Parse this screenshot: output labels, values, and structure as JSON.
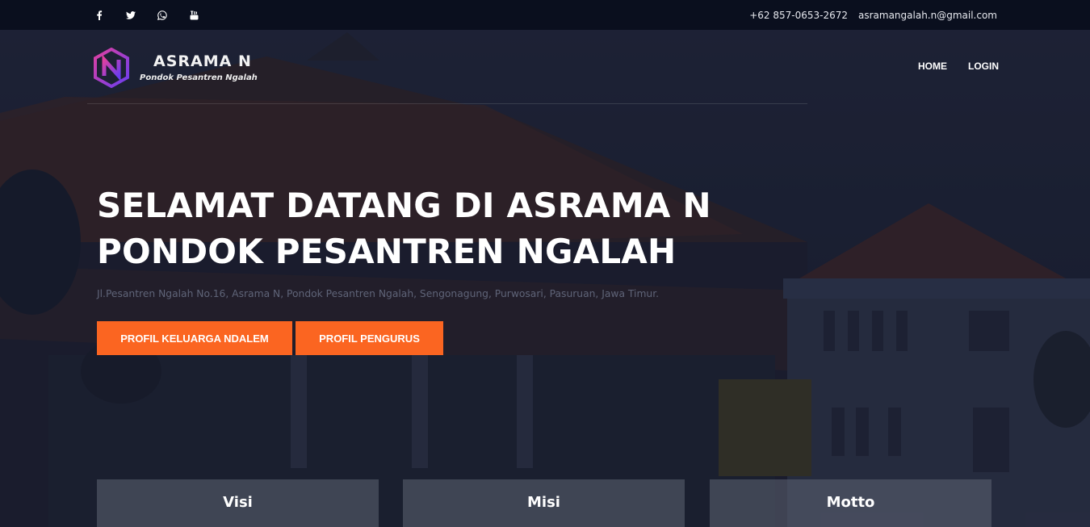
{
  "topbar": {
    "social_icons": [
      "facebook-icon",
      "twitter-icon",
      "whatsapp-icon",
      "youtube-icon"
    ],
    "phone": "+62 857-0653-2672",
    "email": "asramangalah.n@gmail.com"
  },
  "header": {
    "brand_name": "ASRAMA N",
    "brand_sub": "Pondok Pesantren Ngalah",
    "nav": [
      "HOME",
      "LOGIN"
    ]
  },
  "hero": {
    "title_line1": "SELAMAT DATANG DI ASRAMA N",
    "title_line2": "PONDOK PESANTREN NGALAH",
    "address": "Jl.Pesantren Ngalah No.16, Asrama N, Pondok Pesantren Ngalah, Sengonagung, Purwosari, Pasuruan, Jawa Timur.",
    "button1": "PROFIL KELUARGA NDALEM",
    "button2": "PROFIL PENGURUS"
  },
  "cards": [
    "Visi",
    "Misi",
    "Motto"
  ],
  "colors": {
    "accent": "#fb6521",
    "topbar": "#0a0f1e",
    "logo_gradient_start": "#e040a0",
    "logo_gradient_end": "#6a3df0"
  }
}
